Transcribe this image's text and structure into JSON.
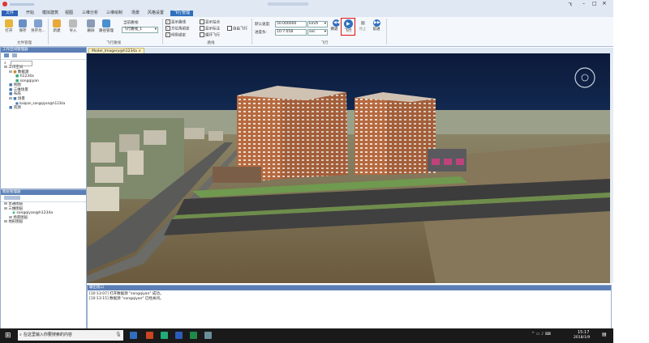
{
  "window": {
    "title_right_mark": "飞",
    "help": "?"
  },
  "menu": {
    "file": "文件",
    "items": [
      "开始",
      "模拟建筑",
      "视图",
      "三维分析",
      "三维绘制",
      "场景",
      "风格设置"
    ],
    "active": "飞行管理"
  },
  "ribbon": {
    "open": "打开",
    "save": "保存",
    "save_as": "另存为...",
    "new": "新建",
    "import": "导入",
    "delete": "删除",
    "route_manage": "路径管理",
    "route_select_label": "当前路线:",
    "route_select_value": "飞行路线_1",
    "group_file": "文件管理",
    "group_flight_route": "飞行路线",
    "checks": [
      {
        "label": "显示路线",
        "checked": true
      },
      {
        "label": "显示站点",
        "checked": false
      },
      {
        "label": "显示标注",
        "checked": false
      },
      {
        "label": "循环飞行",
        "checked": false
      },
      {
        "label": "方位角锁定",
        "checked": true
      },
      {
        "label": "倾角锁定",
        "checked": true
      },
      {
        "label": "自由飞行",
        "checked": false
      }
    ],
    "group_route": "路线",
    "speed_label": "默认速度:",
    "speed_value": "50.000000",
    "speed_unit": "km/h",
    "progress_label": "进度条:",
    "progress_value": "10:7:058",
    "progress_unit": "sec",
    "btn_prev": "倒退",
    "btn_play": "飞行",
    "btn_stop": "停止",
    "btn_next": "前进",
    "group_flight": "飞行"
  },
  "workspace_panel": {
    "title": "工作空间管理器",
    "tree": [
      "工作空间",
      "数据源",
      "h1234a",
      "songqiyan",
      "地图",
      "三维场景",
      "布局",
      "场景",
      "kaiqian_songqiyan@h1234a",
      "资源"
    ]
  },
  "layer_panel": {
    "title": "图层管理器",
    "tree": [
      "普通图层",
      "三维图层",
      "songqiyan@h1234a",
      "场景图层",
      "地形图层"
    ]
  },
  "scene_tab": {
    "label": "Model_Imagery@h1234a"
  },
  "output": {
    "title": "输出窗口",
    "lines": [
      "[10:13:07] 打开数据源 \"songqiyan\" 成功。",
      "[10:13:15] 数据源 \"songqiyan\" 已经关闭。"
    ]
  },
  "taskbar": {
    "search_placeholder": "在这里输入你要搜索的内容",
    "time": "15:17",
    "date": "2018/1/9"
  },
  "colors": {
    "accent": "#2f6fbd",
    "highlight_box": "#e01010"
  }
}
